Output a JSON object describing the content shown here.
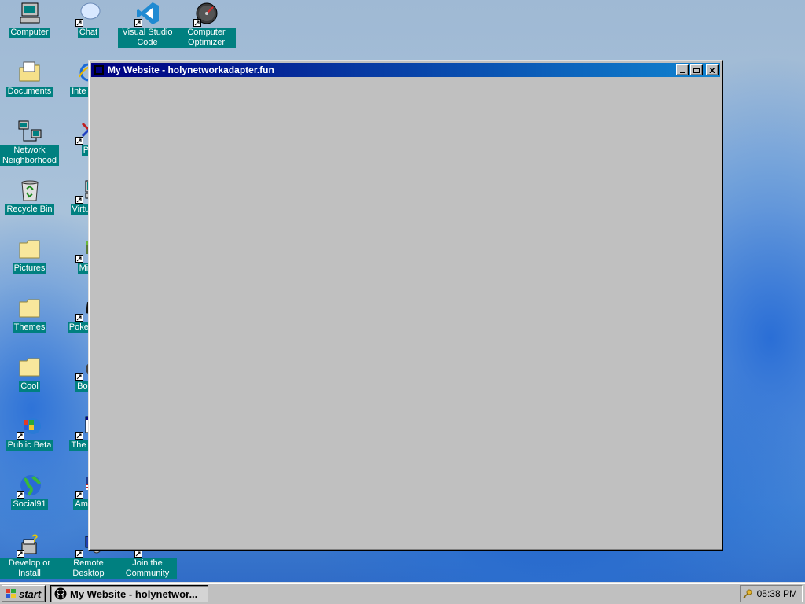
{
  "desktop": {
    "icons": [
      {
        "label": "Computer",
        "icon": "computer-icon"
      },
      {
        "label": "Chat",
        "icon": "chat-bubble-icon"
      },
      {
        "label": "Visual Studio Code",
        "icon": "vscode-icon"
      },
      {
        "label": "Computer Optimizer",
        "icon": "gauge-icon"
      },
      {
        "label": "Documents",
        "icon": "documents-folder-icon"
      },
      {
        "label": "Inte Expl",
        "icon": "internet-explorer-icon"
      },
      {
        "label": "Network Neighborhood",
        "icon": "network-icon"
      },
      {
        "label": "Pa",
        "icon": "paint-icon"
      },
      {
        "label": "Recycle Bin",
        "icon": "recycle-bin-icon"
      },
      {
        "label": "Virtual N",
        "icon": "virtual-machine-icon"
      },
      {
        "label": "Pictures",
        "icon": "folder-icon"
      },
      {
        "label": "Mine",
        "icon": "minecraft-icon"
      },
      {
        "label": "Themes",
        "icon": "folder-icon"
      },
      {
        "label": "Poke Plati",
        "icon": "pokemon-icon"
      },
      {
        "label": "Cool",
        "icon": "folder-icon"
      },
      {
        "label": "Bomb",
        "icon": "bomb-icon"
      },
      {
        "label": "Public Beta",
        "icon": "windows-flag-icon"
      },
      {
        "label": "The Desi",
        "icon": "window-app-icon"
      },
      {
        "label": "Social91",
        "icon": "globe-icon"
      },
      {
        "label": "Americ",
        "icon": "flag-icon"
      },
      {
        "label": "Develop or Install",
        "icon": "setup-question-icon"
      },
      {
        "label": "Remote Desktop",
        "icon": "remote-desktop-icon"
      },
      {
        "label": "Join the Community",
        "icon": "community-icon"
      }
    ]
  },
  "window": {
    "title": "My Website - holynetworkadapter.fun",
    "minimize": "minimize-icon",
    "maximize": "maximize-icon",
    "close": "close-icon"
  },
  "taskbar": {
    "start_label": "start",
    "task_label": "My Website - holynetwor...",
    "clock": "05:38 PM"
  }
}
